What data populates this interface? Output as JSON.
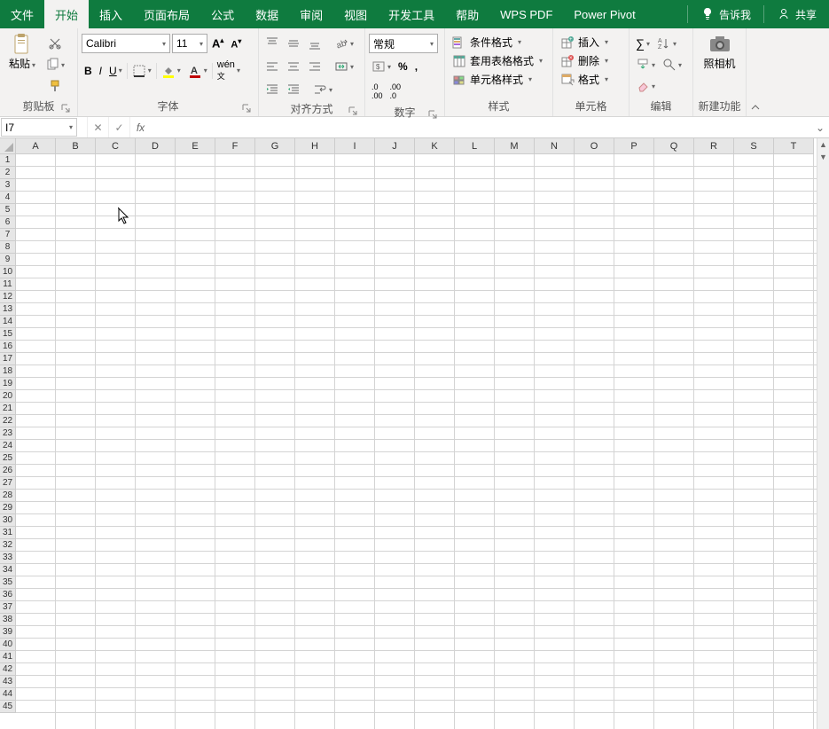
{
  "tabs": {
    "items": [
      "文件",
      "开始",
      "插入",
      "页面布局",
      "公式",
      "数据",
      "审阅",
      "视图",
      "开发工具",
      "帮助",
      "WPS PDF",
      "Power Pivot"
    ],
    "active_index": 1,
    "tell_me": "告诉我",
    "share": "共享"
  },
  "ribbon": {
    "clipboard": {
      "paste": "粘贴",
      "label": "剪贴板"
    },
    "font": {
      "name": "Calibri",
      "size": "11",
      "label": "字体"
    },
    "alignment": {
      "label": "对齐方式"
    },
    "number": {
      "format": "常规",
      "label": "数字"
    },
    "styles": {
      "conditional": "条件格式",
      "table": "套用表格格式",
      "cell": "单元格样式",
      "label": "样式"
    },
    "cells": {
      "insert": "插入",
      "delete": "删除",
      "format": "格式",
      "label": "单元格"
    },
    "editing": {
      "label": "编辑"
    },
    "camera": {
      "name": "照相机",
      "label": "新建功能"
    }
  },
  "namebox": {
    "value": "I7"
  },
  "grid": {
    "columns": [
      "A",
      "B",
      "C",
      "D",
      "E",
      "F",
      "G",
      "H",
      "I",
      "J",
      "K",
      "L",
      "M",
      "N",
      "O",
      "P",
      "Q",
      "R",
      "S",
      "T"
    ],
    "rows": 45
  }
}
